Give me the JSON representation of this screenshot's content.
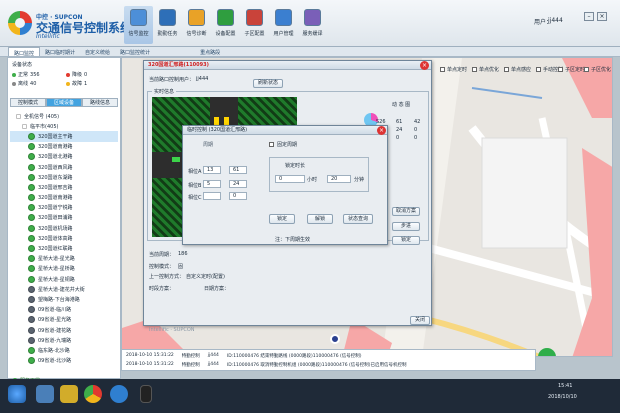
{
  "app": {
    "brand_top": "中控 · SUPCON",
    "title": "交通信号控制系统",
    "subtitle": "Intellific",
    "user_label": "用户：",
    "user_name": "jj444"
  },
  "nav": [
    {
      "label": "信号监控",
      "color": "#4d8fd8"
    },
    {
      "label": "勤勤任务",
      "color": "#2e6fb8"
    },
    {
      "label": "信号诊断",
      "color": "#e9a227"
    },
    {
      "label": "设备配置",
      "color": "#2f9e3f"
    },
    {
      "label": "子区配置",
      "color": "#c9433a"
    },
    {
      "label": "用户管理",
      "color": "#3b7fd0"
    },
    {
      "label": "服务缓译",
      "color": "#7a5fb8"
    }
  ],
  "tabs": [
    "路口监控",
    "路口临时期计",
    "自定义统给",
    "路口监控统计",
    "",
    "重点路段"
  ],
  "sidebar": {
    "status_title": "设备状态",
    "stats": [
      {
        "label": "正常",
        "value": "356",
        "color": "#3fae4a"
      },
      {
        "label": "降级",
        "value": "0",
        "color": "#e23a2f"
      },
      {
        "label": "离线",
        "value": "40",
        "color": "#888888"
      },
      {
        "label": "故障",
        "value": "1",
        "color": "#f2b51b"
      }
    ],
    "tabs": [
      "控制模式",
      "区域设备",
      "路线信息"
    ],
    "tree": [
      {
        "label": "全机信号 (405)",
        "indent": 6,
        "type": "group"
      },
      {
        "label": "临平市(405)",
        "indent": 12,
        "type": "group"
      },
      {
        "label": "320国道主干路",
        "indent": 18,
        "type": "green"
      },
      {
        "label": "320国道南港路",
        "indent": 18,
        "type": "green"
      },
      {
        "label": "320国道北港路",
        "indent": 18,
        "type": "green"
      },
      {
        "label": "320国道西风路",
        "indent": 18,
        "type": "green"
      },
      {
        "label": "320国道东湖路",
        "indent": 18,
        "type": "green"
      },
      {
        "label": "320国道邢吉路",
        "indent": 18,
        "type": "green"
      },
      {
        "label": "320国道南港路",
        "indent": 18,
        "type": "green"
      },
      {
        "label": "320国道宁锐路",
        "indent": 18,
        "type": "green"
      },
      {
        "label": "320国道田浦路",
        "indent": 18,
        "type": "green"
      },
      {
        "label": "320国道机场路",
        "indent": 18,
        "type": "green"
      },
      {
        "label": "320国道体高路",
        "indent": 18,
        "type": "green"
      },
      {
        "label": "320国道红联路",
        "indent": 18,
        "type": "green"
      },
      {
        "label": "星桥大道-星光路",
        "indent": 18,
        "type": "green"
      },
      {
        "label": "星桥大道-星桥路",
        "indent": 18,
        "type": "green"
      },
      {
        "label": "星桥大道-星铜路",
        "indent": 18,
        "type": "green"
      },
      {
        "label": "星桥大道-建花井大街",
        "indent": 18,
        "type": "gray"
      },
      {
        "label": "望梅路-下台海港路",
        "indent": 18,
        "type": "gray"
      },
      {
        "label": "09省道-临川路",
        "indent": 18,
        "type": "gray"
      },
      {
        "label": "09省道-星光路",
        "indent": 18,
        "type": "gray"
      },
      {
        "label": "09省道-建花路",
        "indent": 18,
        "type": "gray"
      },
      {
        "label": "09省道-九瑞路",
        "indent": 18,
        "type": "gray"
      },
      {
        "label": "临东路-北沙路",
        "indent": 18,
        "type": "green"
      },
      {
        "label": "09省道-北沙路",
        "indent": 18,
        "type": "green"
      }
    ],
    "status_text": "服务正常"
  },
  "map": {
    "legend": [
      "单点定时",
      "单点优化",
      "单点感应",
      "手动控制",
      "子区定时",
      "子区优化"
    ]
  },
  "log": [
    {
      "time": "2018-10-10 15:31:22",
      "type": "特勤控制",
      "user": "jj444",
      "msg": "ID:110000476 结束特勤路线 (0000路段)110000476 (信号控制)"
    },
    {
      "time": "2018-10-10 15:31:22",
      "type": "特勤控制",
      "user": "jj444",
      "msg": "ID:110000476 取消特勤控制机组 (0000路段)110000476 (信号控制)已启用信号机控制"
    }
  ],
  "win_outer": {
    "title": "320国道汇邢路(110093)",
    "current_label": "当前路口控制用户：",
    "current_user": "jj444",
    "refresh_label": "刷新状态",
    "realtime_label": "实时信息",
    "table_header": "动 态 图",
    "table_rows": [
      [
        "S26",
        "61",
        "42"
      ],
      [
        "206",
        "24",
        "0"
      ],
      [
        "306",
        "0",
        "0"
      ]
    ],
    "cycle_label": "当前周期：",
    "cycle_value": "186",
    "control_label": "控制模式：",
    "control_value": "固",
    "prev_label": "上一控制方式：",
    "prev_value": "自定义定时(配置)",
    "plan_label": "时段方案：",
    "plan_value": "",
    "day_label": "日期方案：",
    "day_value": "",
    "right_buttons": [
      "取消方案",
      "步进",
      "锁定"
    ],
    "footer": "Intellific · SUPCON",
    "close_label": "关闭"
  },
  "win_inner": {
    "title": "临时控制 (320国道汇邢路)",
    "phase_label": "周期",
    "fixed_cycle_label": "固定周期",
    "phase_rows": [
      {
        "label": "相位A",
        "a": "13",
        "b": "61"
      },
      {
        "label": "相位B",
        "a": "5",
        "b": "24"
      },
      {
        "label": "相位C",
        "a": "",
        "b": "0"
      }
    ],
    "duration_label": "锁定时长",
    "hours_value": "0",
    "hours_unit": "小时",
    "minutes_value": "20",
    "minutes_unit": "分钟",
    "lock_button": "锁定",
    "unlock_button": "解锁",
    "query_button": "状态查询",
    "note": "注：下周期生效"
  },
  "taskbar": {
    "time": "15:41",
    "date": "2018/10/10"
  }
}
